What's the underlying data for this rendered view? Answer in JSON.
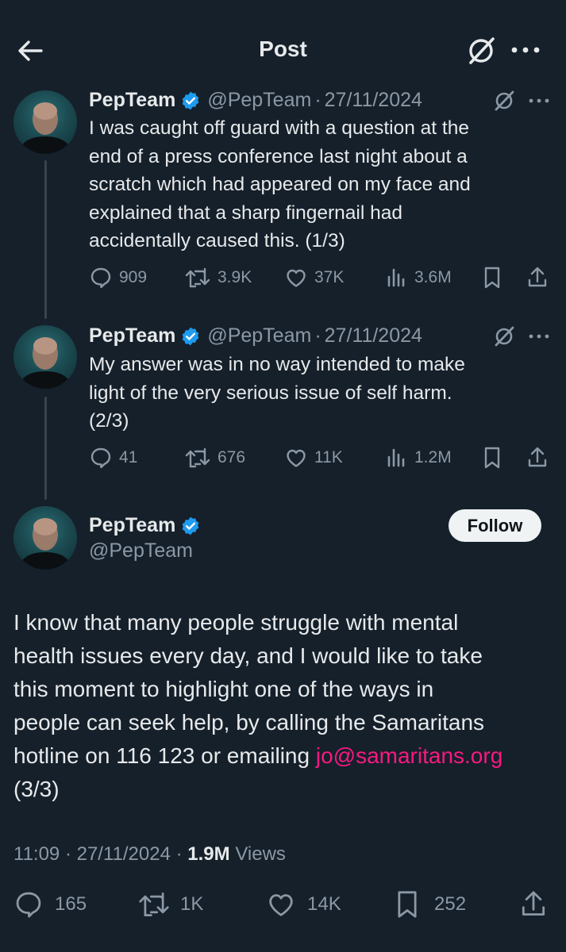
{
  "header": {
    "title": "Post",
    "back_icon": "arrow-left-icon",
    "grok_icon": "grok-icon",
    "more_icon": "more-horizontal-icon"
  },
  "colors": {
    "background": "#15202b",
    "text": "#e7e9ea",
    "muted": "#8b98a5",
    "verified": "#1d9bf0",
    "link": "#f91880",
    "follow_bg": "#eff3f4"
  },
  "replies": [
    {
      "name": "PepTeam",
      "handle": "@PepTeam",
      "date": "27/11/2024",
      "line1": "I was caught off guard with a question at the",
      "line2": "end of a press conference last night about a",
      "line3": "scratch which had appeared on my face and",
      "line4": "explained that a sharp fingernail had",
      "line5": "accidentally caused this. (1/3)",
      "replies": "909",
      "reposts": "3.9K",
      "likes": "37K",
      "views": "3.6M"
    },
    {
      "name": "PepTeam",
      "handle": "@PepTeam",
      "date": "27/11/2024",
      "line1": "My answer was in no way intended to make",
      "line2": "light of the very serious issue of self harm.",
      "line3": "(2/3)",
      "replies": "41",
      "reposts": "676",
      "likes": "11K",
      "views": "1.2M"
    }
  ],
  "main": {
    "name": "PepTeam",
    "handle": "@PepTeam",
    "follow_label": "Follow",
    "line1": "I know that many people struggle with mental",
    "line2": "health issues every day, and I would like to take",
    "line3": "this moment to highlight one of the ways in",
    "line4": "people can seek help, by calling the Samaritans",
    "line5_prefix": "hotline on 116 123 or emailing ",
    "link": "jo@samaritans.org",
    "line6": "(3/3)",
    "time": "11:09",
    "date": "27/11/2024",
    "views_count": "1.9M",
    "views_label": "Views",
    "replies": "165",
    "reposts": "1K",
    "likes": "14K",
    "bookmarks": "252"
  }
}
